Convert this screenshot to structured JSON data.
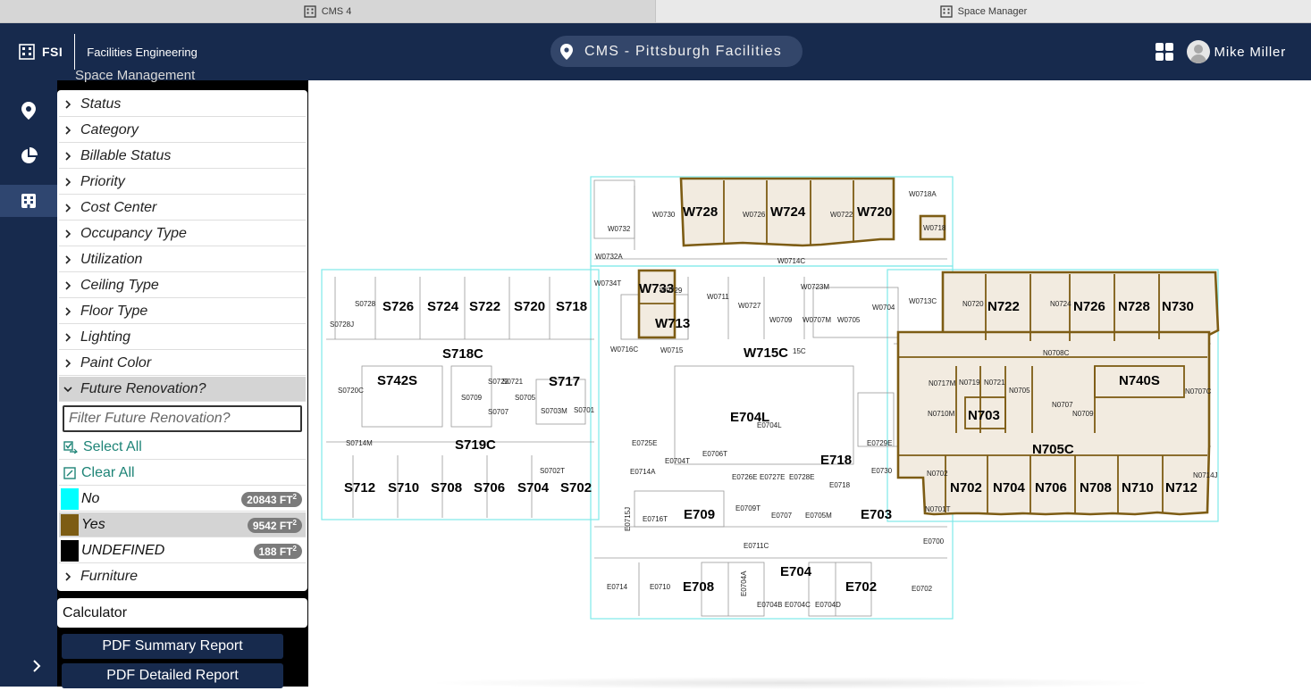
{
  "browser_tabs": [
    {
      "label": "CMS 4",
      "active": false
    },
    {
      "label": "Space Manager",
      "active": true
    }
  ],
  "header": {
    "logo_text": "FSI",
    "brand_name": "Facilities Engineering",
    "site_name": "CMS - Pittsburgh Facilities",
    "user_name": "Mike Miller"
  },
  "panel": {
    "title": "Space Management",
    "filters": [
      {
        "label": "Status"
      },
      {
        "label": "Category"
      },
      {
        "label": "Billable Status"
      },
      {
        "label": "Priority"
      },
      {
        "label": "Cost Center"
      },
      {
        "label": "Occupancy Type"
      },
      {
        "label": "Utilization"
      },
      {
        "label": "Ceiling Type"
      },
      {
        "label": "Floor Type"
      },
      {
        "label": "Lighting"
      },
      {
        "label": "Paint Color"
      },
      {
        "label": "Future Renovation?",
        "expanded": true
      }
    ],
    "filter_placeholder": "Filter Future Renovation?",
    "select_all": "Select All",
    "clear_all": "Clear All",
    "values": [
      {
        "label": "No",
        "color": "#00ffff",
        "area": "20843",
        "unit": "FT",
        "selected": false
      },
      {
        "label": "Yes",
        "color": "#7d5c14",
        "area": "9542",
        "unit": "FT",
        "selected": true
      },
      {
        "label": "UNDEFINED",
        "color": "#000000",
        "area": "188",
        "unit": "FT",
        "selected": false
      }
    ],
    "furniture": "Furniture",
    "calculator": "Calculator",
    "reports": [
      "PDF Summary Report",
      "PDF Detailed Report"
    ]
  },
  "colors": {
    "navy": "#172a4d",
    "renovation_yes": "#7d5c14",
    "renovation_no": "#00ffff",
    "yes_fill": "#f2ebe0",
    "teal_action": "#1e8477"
  },
  "map": {
    "rooms_large": [
      "W728",
      "W724",
      "W720",
      "W733",
      "W713",
      "W715C",
      "N722",
      "N726",
      "N728",
      "N730",
      "S726",
      "S724",
      "S722",
      "S720",
      "S718",
      "S718C",
      "S742S",
      "S717",
      "N740S",
      "N703",
      "E704L",
      "S719C",
      "E718",
      "N705C",
      "S712",
      "S710",
      "S708",
      "S706",
      "S704",
      "S702",
      "N702",
      "N704",
      "N706",
      "N708",
      "N710",
      "N712",
      "E709",
      "E703",
      "E704",
      "E708",
      "E702"
    ],
    "rooms_small": [
      "W0730",
      "W0726",
      "W0722",
      "W0718A",
      "W0732",
      "W0718",
      "W0732A",
      "W0714C",
      "W0734T",
      "W0729",
      "W0711",
      "W0723M",
      "W0727",
      "W0709",
      "W0707M",
      "W0705",
      "W0704",
      "W0713C",
      "W0716C",
      "W0715",
      "N0720",
      "N0724",
      "N0708C",
      "N0717M",
      "N0719",
      "N0721",
      "N0705",
      "N0707",
      "N0709",
      "N0707C",
      "N0710M",
      "S0728",
      "S0728J",
      "S0720C",
      "S0723",
      "S0721",
      "S0709",
      "S0705",
      "S0707",
      "S0703M",
      "S0701",
      "S0714M",
      "S0702T",
      "E0725E",
      "E0704T",
      "E0706T",
      "E0714A",
      "E0726E",
      "E0727E",
      "E0728E",
      "E0729E",
      "E0730",
      "E0718",
      "E0716T",
      "E0715J",
      "E0709T",
      "E0707",
      "E0705M",
      "E0711C",
      "E0700",
      "E0714",
      "E0710",
      "E0704A",
      "E0704B",
      "E0704C",
      "E0704D",
      "E0702",
      "N0702",
      "N0701T",
      "N0714J",
      "E0704L",
      "15C"
    ]
  }
}
